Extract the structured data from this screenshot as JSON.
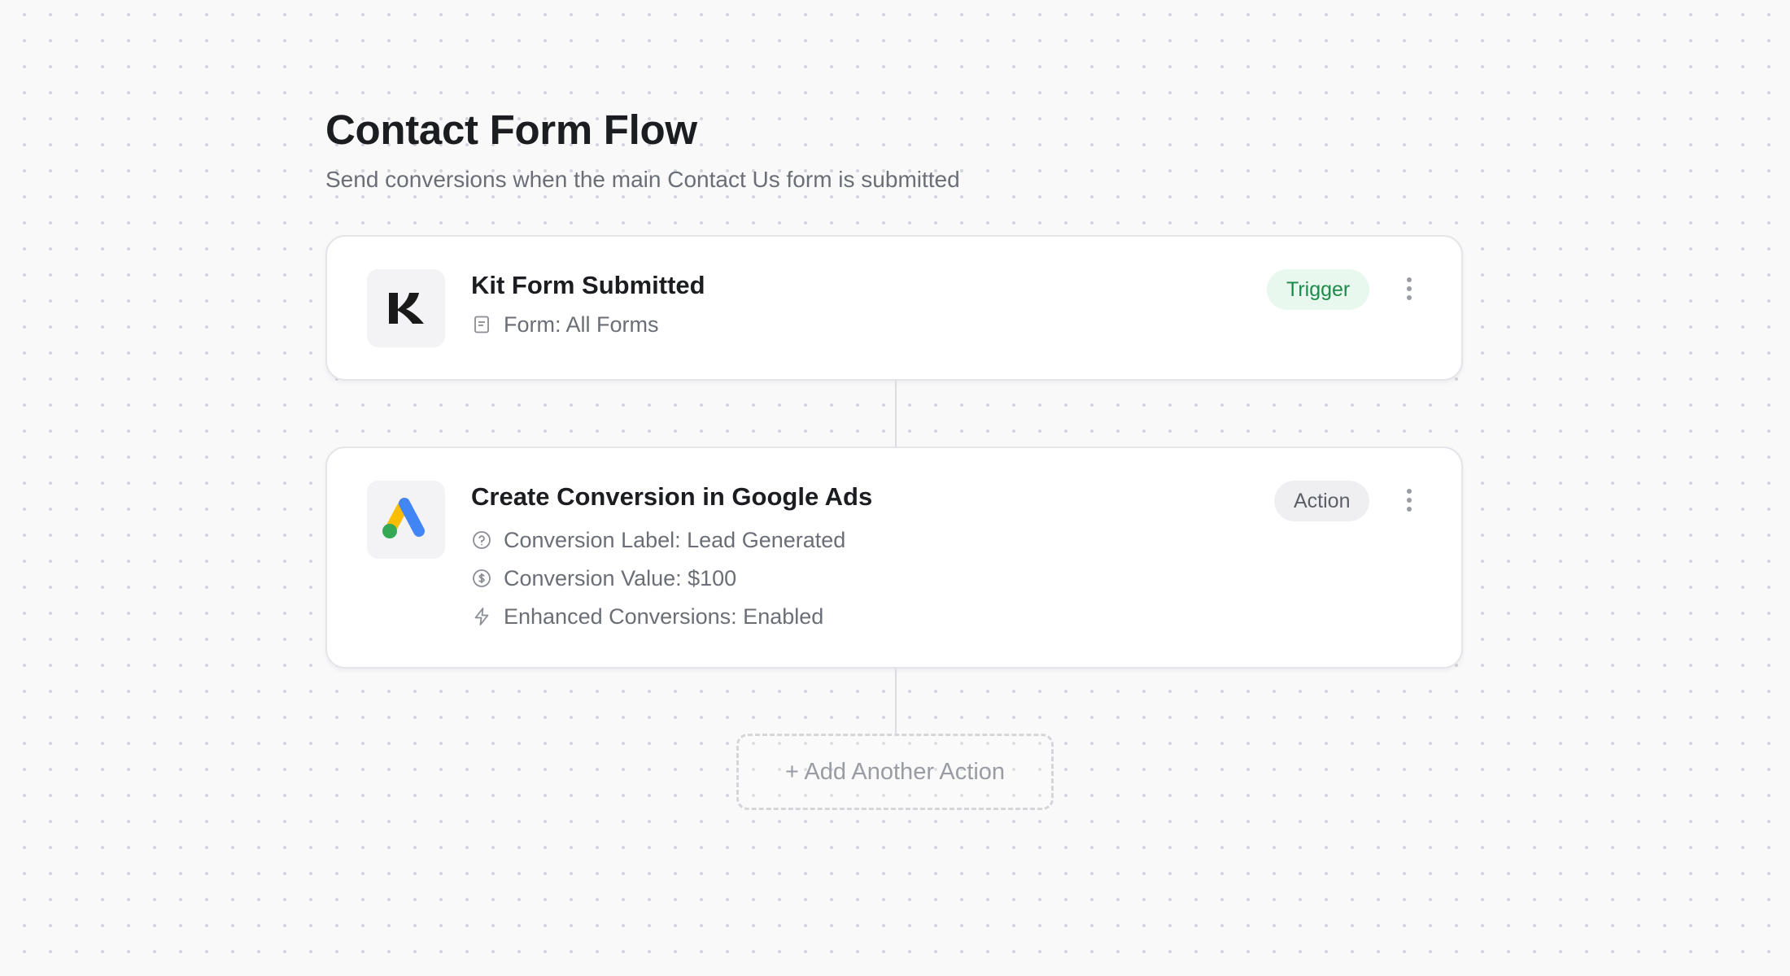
{
  "flow": {
    "title": "Contact Form Flow",
    "subtitle": "Send conversions when the main Contact Us form is submitted"
  },
  "trigger_step": {
    "logo": "kit-logo",
    "title": "Kit Form Submitted",
    "badge": "Trigger",
    "badge_color": "#1e8a4a",
    "details": [
      {
        "icon": "form-icon",
        "text": "Form: All Forms"
      }
    ]
  },
  "action_step": {
    "logo": "google-ads-logo",
    "title": "Create Conversion in Google Ads",
    "badge": "Action",
    "details": [
      {
        "icon": "question-circle-icon",
        "text": "Conversion Label: Lead Generated"
      },
      {
        "icon": "dollar-circle-icon",
        "text": "Conversion Value: $100"
      },
      {
        "icon": "lightning-icon",
        "text": "Enhanced Conversions: Enabled"
      }
    ]
  },
  "add_action": {
    "label": "+ Add Another Action"
  },
  "colors": {
    "google_blue": "#4285F4",
    "google_yellow": "#FBBC04",
    "google_green": "#34A853"
  }
}
